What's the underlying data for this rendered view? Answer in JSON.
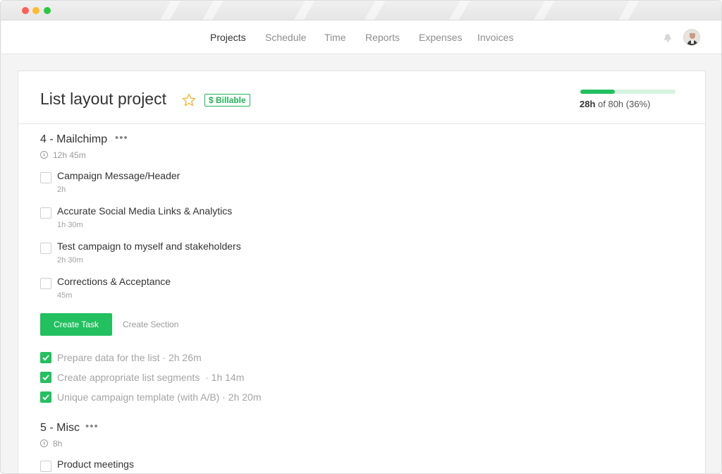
{
  "colors": {
    "accent": "#22c05f",
    "billable": "#22b357",
    "star": "#f5b83d"
  },
  "nav": {
    "items": [
      {
        "label": "Projects",
        "active": true
      },
      {
        "label": "Schedule",
        "active": false
      },
      {
        "label": "Time",
        "active": false
      },
      {
        "label": "Reports",
        "active": false
      },
      {
        "label": "Expenses",
        "active": false
      },
      {
        "label": "Invoices",
        "active": false
      }
    ],
    "icons": [
      "bell-icon",
      "avatar"
    ]
  },
  "project": {
    "title": "List layout project",
    "billable_label": "$ Billable",
    "progress": {
      "fraction": 0.36,
      "hours_used": "28h",
      "of_text": " of 80h (36%)"
    }
  },
  "sections": [
    {
      "title": "4 - Mailchimp",
      "total": "12h 45m",
      "tasks": [
        {
          "name": "Campaign Message/Header",
          "duration": "2h"
        },
        {
          "name": "Accurate Social Media Links & Analytics",
          "duration": "1h 30m"
        },
        {
          "name": "Test campaign to myself and stakeholders",
          "duration": "2h 30m"
        },
        {
          "name": "Corrections & Acceptance",
          "duration": "45m"
        }
      ],
      "create_task_label": "Create Task",
      "create_section_label": "Create Section",
      "completed": [
        {
          "text": "Prepare data for the list · 2h 26m"
        },
        {
          "text": "Create appropriate list segments  · 1h 14m"
        },
        {
          "text": "Unique campaign template (with A/B) · 2h 20m"
        }
      ]
    },
    {
      "title": "5 - Misc",
      "total": "8h",
      "tasks": [
        {
          "name": "Product meetings",
          "duration": ""
        }
      ]
    }
  ]
}
